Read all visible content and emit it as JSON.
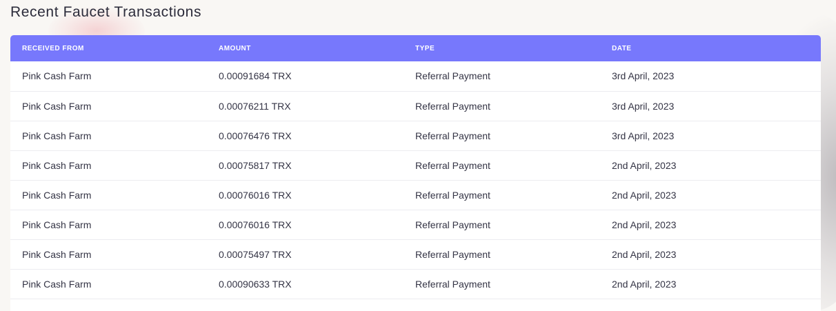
{
  "page": {
    "title": "Recent Faucet Transactions"
  },
  "table": {
    "columns": [
      "RECEIVED FROM",
      "AMOUNT",
      "TYPE",
      "DATE"
    ],
    "rows": [
      {
        "from": "Pink Cash Farm",
        "amount": "0.00091684 TRX",
        "type": "Referral Payment",
        "date": "3rd April, 2023"
      },
      {
        "from": "Pink Cash Farm",
        "amount": "0.00076211 TRX",
        "type": "Referral Payment",
        "date": "3rd April, 2023"
      },
      {
        "from": "Pink Cash Farm",
        "amount": "0.00076476 TRX",
        "type": "Referral Payment",
        "date": "3rd April, 2023"
      },
      {
        "from": "Pink Cash Farm",
        "amount": "0.00075817 TRX",
        "type": "Referral Payment",
        "date": "2nd April, 2023"
      },
      {
        "from": "Pink Cash Farm",
        "amount": "0.00076016 TRX",
        "type": "Referral Payment",
        "date": "2nd April, 2023"
      },
      {
        "from": "Pink Cash Farm",
        "amount": "0.00076016 TRX",
        "type": "Referral Payment",
        "date": "2nd April, 2023"
      },
      {
        "from": "Pink Cash Farm",
        "amount": "0.00075497 TRX",
        "type": "Referral Payment",
        "date": "2nd April, 2023"
      },
      {
        "from": "Pink Cash Farm",
        "amount": "0.00090633 TRX",
        "type": "Referral Payment",
        "date": "2nd April, 2023"
      }
    ]
  },
  "colors": {
    "header_bg": "#7778fc",
    "page_bg": "#f9f7f4",
    "text": "#333344"
  }
}
